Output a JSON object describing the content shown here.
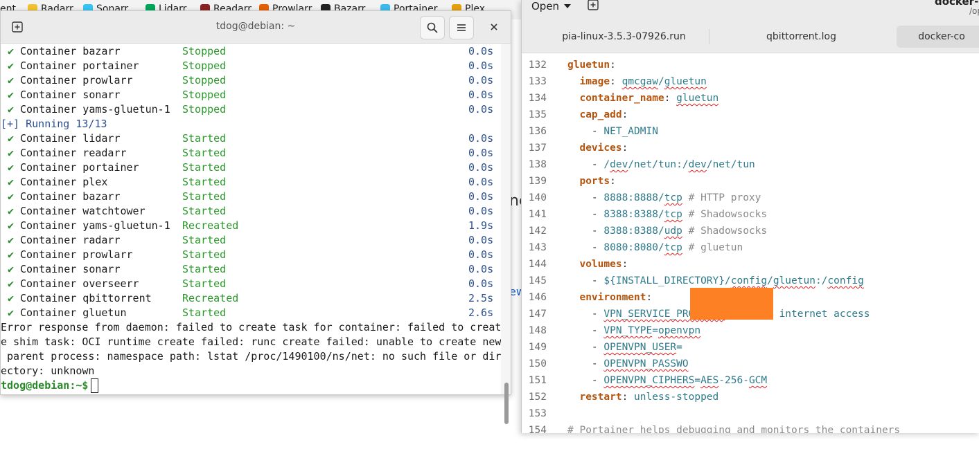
{
  "bookmarks": [
    {
      "label": "ent",
      "color": ""
    },
    {
      "label": "Radarr",
      "color": "#f2c330"
    },
    {
      "label": "Sonarr",
      "color": "#35c5f4"
    },
    {
      "label": "Lidarr",
      "color": "#00a65b"
    },
    {
      "label": "Readarr",
      "color": "#8e2222"
    },
    {
      "label": "Prowlarr",
      "color": "#e66000"
    },
    {
      "label": "Bazarr",
      "color": "#222222"
    },
    {
      "label": "Portainer",
      "color": "#3bbced"
    },
    {
      "label": "Plex",
      "color": "#e5a00d"
    }
  ],
  "background_fragments": {
    "text1": "ne",
    "link1": "ew"
  },
  "terminal": {
    "title": "tdog@debian: ~",
    "stopped": [
      {
        "name": "Container bazarr",
        "status": "Stopped",
        "time": "0.0s"
      },
      {
        "name": "Container portainer",
        "status": "Stopped",
        "time": "0.0s"
      },
      {
        "name": "Container prowlarr",
        "status": "Stopped",
        "time": "0.0s"
      },
      {
        "name": "Container sonarr",
        "status": "Stopped",
        "time": "0.0s"
      },
      {
        "name": "Container yams-gluetun-1",
        "status": "Stopped",
        "time": "0.0s"
      }
    ],
    "running_header": "[+] Running 13/13",
    "running": [
      {
        "name": "Container lidarr",
        "status": "Started",
        "time": "0.0s"
      },
      {
        "name": "Container readarr",
        "status": "Started",
        "time": "0.0s"
      },
      {
        "name": "Container portainer",
        "status": "Started",
        "time": "0.0s"
      },
      {
        "name": "Container plex",
        "status": "Started",
        "time": "0.0s"
      },
      {
        "name": "Container bazarr",
        "status": "Started",
        "time": "0.0s"
      },
      {
        "name": "Container watchtower",
        "status": "Started",
        "time": "0.0s"
      },
      {
        "name": "Container yams-gluetun-1",
        "status": "Recreated",
        "time": "1.9s"
      },
      {
        "name": "Container radarr",
        "status": "Started",
        "time": "0.0s"
      },
      {
        "name": "Container prowlarr",
        "status": "Started",
        "time": "0.0s"
      },
      {
        "name": "Container sonarr",
        "status": "Started",
        "time": "0.0s"
      },
      {
        "name": "Container overseerr",
        "status": "Started",
        "time": "0.0s"
      },
      {
        "name": "Container qbittorrent",
        "status": "Recreated",
        "time": "2.5s"
      },
      {
        "name": "Container gluetun",
        "status": "Started",
        "time": "2.6s"
      }
    ],
    "error_lines": [
      "Error response from daemon: failed to create task for container: failed to creat",
      "e shim task: OCI runtime create failed: runc create failed: unable to create new",
      " parent process: namespace path: lstat /proc/1490100/ns/net: no such file or dir",
      "ectory: unknown"
    ],
    "prompt": "tdog@debian:~$"
  },
  "editor": {
    "open_label": "Open",
    "title": "docker-co",
    "subtitle": "/op",
    "tabs": [
      "pia-linux-3.5.3-07926.run",
      "qbittorrent.log",
      "docker-co"
    ],
    "lines": [
      {
        "n": "132",
        "ind": 0,
        "segs": [
          {
            "t": "gluetun",
            "c": "k"
          },
          {
            "t": ":",
            "c": ""
          }
        ]
      },
      {
        "n": "133",
        "ind": 2,
        "segs": [
          {
            "t": "image",
            "c": "k"
          },
          {
            "t": ": ",
            "c": ""
          },
          {
            "t": "qmcgaw",
            "c": "v u"
          },
          {
            "t": "/",
            "c": "v"
          },
          {
            "t": "gluetun",
            "c": "v u"
          }
        ]
      },
      {
        "n": "134",
        "ind": 2,
        "segs": [
          {
            "t": "container_name",
            "c": "k"
          },
          {
            "t": ": ",
            "c": ""
          },
          {
            "t": "gluetun",
            "c": "v u"
          }
        ]
      },
      {
        "n": "135",
        "ind": 2,
        "segs": [
          {
            "t": "cap_add",
            "c": "k"
          },
          {
            "t": ":",
            "c": ""
          }
        ]
      },
      {
        "n": "136",
        "ind": 4,
        "segs": [
          {
            "t": "- ",
            "c": ""
          },
          {
            "t": "NET_ADMIN",
            "c": "v"
          }
        ]
      },
      {
        "n": "137",
        "ind": 2,
        "segs": [
          {
            "t": "devices",
            "c": "k"
          },
          {
            "t": ":",
            "c": ""
          }
        ]
      },
      {
        "n": "138",
        "ind": 4,
        "segs": [
          {
            "t": "- ",
            "c": ""
          },
          {
            "t": "/",
            "c": "v"
          },
          {
            "t": "dev",
            "c": "v u"
          },
          {
            "t": "/net/tun:/",
            "c": "v"
          },
          {
            "t": "dev",
            "c": "v u"
          },
          {
            "t": "/net/tun",
            "c": "v"
          }
        ]
      },
      {
        "n": "139",
        "ind": 2,
        "segs": [
          {
            "t": "ports",
            "c": "k"
          },
          {
            "t": ":",
            "c": ""
          }
        ]
      },
      {
        "n": "140",
        "ind": 4,
        "segs": [
          {
            "t": "- ",
            "c": ""
          },
          {
            "t": "8888:8888/",
            "c": "v"
          },
          {
            "t": "tcp",
            "c": "v u"
          },
          {
            "t": " # HTTP proxy",
            "c": "c"
          }
        ]
      },
      {
        "n": "141",
        "ind": 4,
        "segs": [
          {
            "t": "- ",
            "c": ""
          },
          {
            "t": "8388:8388/",
            "c": "v"
          },
          {
            "t": "tcp",
            "c": "v u"
          },
          {
            "t": " # Shadowsocks",
            "c": "c"
          }
        ]
      },
      {
        "n": "142",
        "ind": 4,
        "segs": [
          {
            "t": "- ",
            "c": ""
          },
          {
            "t": "8388:8388/",
            "c": "v"
          },
          {
            "t": "udp",
            "c": "v u"
          },
          {
            "t": " # Shadowsocks",
            "c": "c"
          }
        ]
      },
      {
        "n": "143",
        "ind": 4,
        "segs": [
          {
            "t": "- ",
            "c": ""
          },
          {
            "t": "8080:8080/",
            "c": "v"
          },
          {
            "t": "tcp",
            "c": "v u"
          },
          {
            "t": " # gluetun",
            "c": "c"
          }
        ]
      },
      {
        "n": "144",
        "ind": 2,
        "segs": [
          {
            "t": "volumes",
            "c": "k"
          },
          {
            "t": ":",
            "c": ""
          }
        ]
      },
      {
        "n": "145",
        "ind": 4,
        "segs": [
          {
            "t": "- ",
            "c": ""
          },
          {
            "t": "${INSTALL_DIRECTORY}/",
            "c": "v"
          },
          {
            "t": "config",
            "c": "v u"
          },
          {
            "t": "/",
            "c": "v"
          },
          {
            "t": "gluetun",
            "c": "v u"
          },
          {
            "t": ":/",
            "c": "v"
          },
          {
            "t": "config",
            "c": "v u"
          }
        ]
      },
      {
        "n": "146",
        "ind": 2,
        "segs": [
          {
            "t": "environment",
            "c": "k"
          },
          {
            "t": ":",
            "c": ""
          }
        ]
      },
      {
        "n": "147",
        "ind": 4,
        "segs": [
          {
            "t": "- ",
            "c": ""
          },
          {
            "t": "VPN_SERVICE_PROVIDER",
            "c": "v u"
          },
          {
            "t": "=private internet access",
            "c": "v"
          }
        ]
      },
      {
        "n": "148",
        "ind": 4,
        "segs": [
          {
            "t": "- ",
            "c": ""
          },
          {
            "t": "VPN_TYPE",
            "c": "v u"
          },
          {
            "t": "=",
            "c": "v"
          },
          {
            "t": "openvpn",
            "c": "v u"
          }
        ]
      },
      {
        "n": "149",
        "ind": 4,
        "segs": [
          {
            "t": "- ",
            "c": ""
          },
          {
            "t": "OPENVPN_USER",
            "c": "v u"
          },
          {
            "t": "=",
            "c": "v"
          }
        ]
      },
      {
        "n": "150",
        "ind": 4,
        "segs": [
          {
            "t": "- ",
            "c": ""
          },
          {
            "t": "OPENVPN_PASSWO",
            "c": "v u"
          }
        ]
      },
      {
        "n": "151",
        "ind": 4,
        "segs": [
          {
            "t": "- ",
            "c": ""
          },
          {
            "t": "OPENVPN_CIPHERS",
            "c": "v u"
          },
          {
            "t": "=",
            "c": "v"
          },
          {
            "t": "AES",
            "c": "v u"
          },
          {
            "t": "-256-",
            "c": "v"
          },
          {
            "t": "GCM",
            "c": "v u"
          }
        ]
      },
      {
        "n": "152",
        "ind": 2,
        "segs": [
          {
            "t": "restart",
            "c": "k"
          },
          {
            "t": ": ",
            "c": ""
          },
          {
            "t": "unless-stopped",
            "c": "v"
          }
        ]
      },
      {
        "n": "153",
        "ind": 0,
        "segs": []
      },
      {
        "n": "154",
        "ind": 0,
        "segs": [
          {
            "t": "# Portainer helps debugging and monitors the containers",
            "c": "c"
          }
        ]
      }
    ]
  }
}
